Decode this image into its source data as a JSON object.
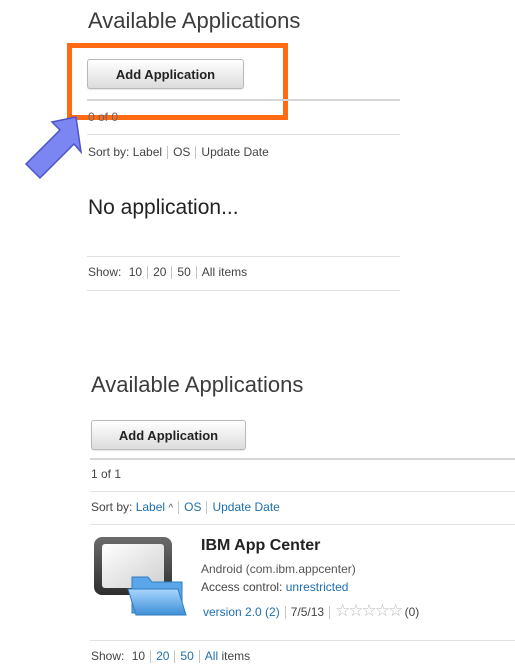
{
  "top": {
    "title": "Available Applications",
    "add_button": "Add Application",
    "count": "0 of 0",
    "sort_by_label": "Sort by:",
    "sort_options": [
      "Label",
      "OS",
      "Update Date"
    ],
    "empty_message": "No application...",
    "show_label": "Show:",
    "show_options": [
      "10",
      "20",
      "50",
      "All",
      "items"
    ]
  },
  "bottom": {
    "title": "Available Applications",
    "add_button": "Add Application",
    "count": "1 of 1",
    "sort_by_label": "Sort by:",
    "sort_options": [
      "Label",
      "OS",
      "Update Date"
    ],
    "sort_indicator": "^",
    "app": {
      "name": "IBM App Center",
      "platform": "Android (com.ibm.appcenter)",
      "access_label": "Access control:",
      "access_value": "unrestricted",
      "version": "version 2.0 (2)",
      "date": "7/5/13",
      "stars": "☆☆☆☆☆",
      "rating_count": "(0)"
    },
    "show_label": "Show:",
    "show_options": [
      "10",
      "20",
      "50",
      "All",
      "items"
    ]
  },
  "colors": {
    "highlight": "#ff6a13",
    "arrow": "#7b86f3",
    "link": "#1f6fae"
  },
  "icons": {
    "arrow": "pointer-arrow-icon",
    "app": "tablet-folder-icon"
  }
}
